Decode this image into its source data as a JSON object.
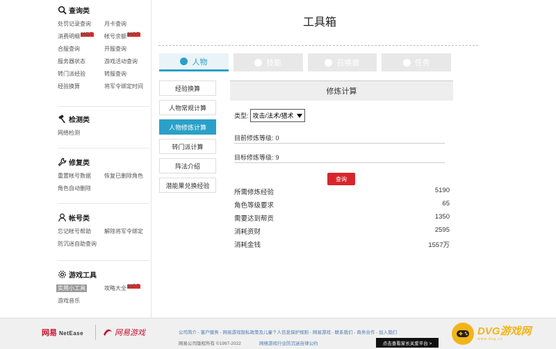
{
  "title": "工具箱",
  "sidebar": {
    "query": {
      "title": "查询类",
      "links": [
        {
          "label": "处罚记录查询",
          "hot": false
        },
        {
          "label": "月卡查询",
          "hot": false
        },
        {
          "label": "消费明细",
          "hot": true
        },
        {
          "label": "帐号余额",
          "hot": true
        },
        {
          "label": "合服查询",
          "hot": false
        },
        {
          "label": "开服查询",
          "hot": false
        },
        {
          "label": "服务器状态",
          "hot": false
        },
        {
          "label": "游戏活动查询",
          "hot": false
        },
        {
          "label": "转门派经验",
          "hot": false
        },
        {
          "label": "转服查询",
          "hot": false
        },
        {
          "label": "经验换算",
          "hot": false
        },
        {
          "label": "将军令绑定时间",
          "hot": false
        }
      ]
    },
    "detect": {
      "title": "检测类",
      "links": [
        {
          "label": "网络检测"
        }
      ]
    },
    "repair": {
      "title": "修复类",
      "links": [
        {
          "label": "重置帐号数据"
        },
        {
          "label": "恢复已删除角色"
        },
        {
          "label": "角色自动删除"
        }
      ]
    },
    "account": {
      "title": "帐号类",
      "links": [
        {
          "label": "忘记帐号帮助"
        },
        {
          "label": "解除将军令绑定"
        },
        {
          "label": "防沉迷自助查询"
        }
      ]
    },
    "gametools": {
      "title": "游戏工具",
      "links": [
        {
          "label": "实用小工具",
          "hot": false,
          "active": true
        },
        {
          "label": "攻略大全",
          "hot": true,
          "active": false
        },
        {
          "label": "游戏音乐",
          "hot": false,
          "active": false
        }
      ]
    },
    "hot_badge": "HOT"
  },
  "tabs": [
    {
      "label": "人物",
      "active": true
    },
    {
      "label": "技能",
      "active": false
    },
    {
      "label": "召唤兽",
      "active": false
    },
    {
      "label": "任务",
      "active": false
    }
  ],
  "leftnav": [
    {
      "label": "经验换算",
      "active": false
    },
    {
      "label": "人物常规计算",
      "active": false
    },
    {
      "label": "人物修炼计算",
      "active": true
    },
    {
      "label": "转门派计算",
      "active": false
    },
    {
      "label": "阵法介绍",
      "active": false
    },
    {
      "label": "潜能果兑换经验",
      "active": false
    }
  ],
  "panel": {
    "title": "修炼计算",
    "type_label": "类型:",
    "type_value": "攻击/法术/猎术",
    "current_label": "目前修炼等级:",
    "current_value": "0",
    "target_label": "目标修炼等级:",
    "target_value": "9",
    "query_button": "查询",
    "results": [
      {
        "label": "所需修炼经验",
        "value": "5190"
      },
      {
        "label": "角色等级要求",
        "value": "65"
      },
      {
        "label": "需要达到帮贡",
        "value": "1350"
      },
      {
        "label": "消耗资财",
        "value": "2595"
      },
      {
        "label": "消耗金钱",
        "value": "1557万"
      }
    ]
  },
  "footer": {
    "logo1": "网易",
    "logo1_en": "NetEase",
    "logo2": "网易游戏",
    "links": "公司简介 - 客户服务 - 网易游戏隐私政策及儿童个人信息保护规则 - 网易游戏 - 联系我们 - 商务合作 - 加入我们",
    "copyright": "网易公司版权所有 ©1997-2022",
    "copyright_link": "网络游戏行业防沉迷自律公约",
    "cta": "点击查看家长关爱平台 >"
  },
  "watermark": {
    "text": "DVG游戏网",
    "sub": "www.dvg.cn"
  },
  "colors": {
    "accent": "#2aa0c8",
    "query_button": "#d7262b",
    "hot": "#e02a2a"
  }
}
